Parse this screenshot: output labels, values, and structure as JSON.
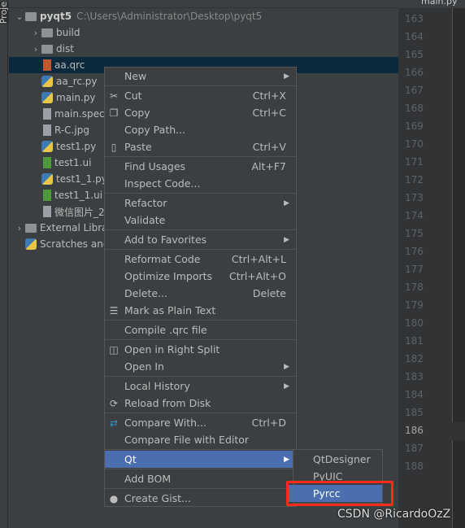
{
  "sidebar_strip": {
    "label": "Proje"
  },
  "editor_tab": {
    "label": "main.py"
  },
  "tree": [
    {
      "label": "pyqt5",
      "path": "C:\\Users\\Administrator\\Desktop\\pyqt5",
      "icon": "folder-icon",
      "level": 0,
      "expanded": true
    },
    {
      "label": "build",
      "icon": "folder-icon",
      "level": 1,
      "collapsed": true
    },
    {
      "label": "dist",
      "icon": "folder-icon",
      "level": 1,
      "collapsed": true
    },
    {
      "label": "aa.qrc",
      "icon": "qrc-file-icon",
      "level": 1,
      "selected": true
    },
    {
      "label": "aa_rc.py",
      "icon": "python-file-icon",
      "level": 1
    },
    {
      "label": "main.py",
      "icon": "python-file-icon",
      "level": 1
    },
    {
      "label": "main.spec",
      "icon": "text-file-icon",
      "level": 1
    },
    {
      "label": "R-C.jpg",
      "icon": "image-file-icon",
      "level": 1
    },
    {
      "label": "test1.py",
      "icon": "python-file-icon",
      "level": 1
    },
    {
      "label": "test1.ui",
      "icon": "qt-ui-file-icon",
      "level": 1
    },
    {
      "label": "test1_1.py",
      "icon": "python-file-icon",
      "level": 1
    },
    {
      "label": "test1_1.ui",
      "icon": "qt-ui-file-icon",
      "level": 1
    },
    {
      "label": "微信图片_2",
      "icon": "image-file-icon",
      "level": 1
    },
    {
      "label": "External Libraries",
      "icon": "library-icon",
      "level": 0,
      "collapsed": true
    },
    {
      "label": "Scratches and Consoles",
      "icon": "scratches-icon",
      "level": 0
    }
  ],
  "line_numbers": [
    "163",
    "164",
    "165",
    "166",
    "167",
    "168",
    "169",
    "170",
    "171",
    "172",
    "173",
    "174",
    "175",
    "176",
    "177",
    "178",
    "179",
    "180",
    "181",
    "182",
    "183",
    "184",
    "185",
    "186",
    "187",
    "188"
  ],
  "current_line": "186",
  "context_menu": [
    {
      "label": "New",
      "submenu": true
    },
    {
      "sep": true
    },
    {
      "label": "Cut",
      "shortcut": "Ctrl+X",
      "icon": "scissors-icon"
    },
    {
      "label": "Copy",
      "shortcut": "Ctrl+C",
      "icon": "copy-icon"
    },
    {
      "label": "Copy Path..."
    },
    {
      "label": "Paste",
      "shortcut": "Ctrl+V",
      "icon": "paste-icon"
    },
    {
      "sep": true
    },
    {
      "label": "Find Usages",
      "shortcut": "Alt+F7"
    },
    {
      "label": "Inspect Code..."
    },
    {
      "sep": true
    },
    {
      "label": "Refactor",
      "submenu": true
    },
    {
      "label": "Validate"
    },
    {
      "sep": true
    },
    {
      "label": "Add to Favorites",
      "submenu": true
    },
    {
      "sep": true
    },
    {
      "label": "Reformat Code",
      "shortcut": "Ctrl+Alt+L"
    },
    {
      "label": "Optimize Imports",
      "shortcut": "Ctrl+Alt+O"
    },
    {
      "label": "Delete...",
      "shortcut": "Delete"
    },
    {
      "label": "Mark as Plain Text",
      "icon": "plain-text-icon"
    },
    {
      "sep": true
    },
    {
      "label": "Compile .qrc file"
    },
    {
      "sep": true
    },
    {
      "label": "Open in Right Split",
      "icon": "split-icon"
    },
    {
      "label": "Open In",
      "submenu": true
    },
    {
      "sep": true
    },
    {
      "label": "Local History",
      "submenu": true
    },
    {
      "label": "Reload from Disk",
      "icon": "reload-icon"
    },
    {
      "sep": true
    },
    {
      "label": "Compare With...",
      "shortcut": "Ctrl+D",
      "icon": "compare-icon"
    },
    {
      "label": "Compare File with Editor"
    },
    {
      "sep": true
    },
    {
      "label": "Qt",
      "submenu": true,
      "highlighted": true
    },
    {
      "sep": true
    },
    {
      "label": "Add BOM"
    },
    {
      "sep": true
    },
    {
      "label": "Create Gist...",
      "icon": "github-icon"
    }
  ],
  "qt_submenu": [
    {
      "label": "QtDesigner"
    },
    {
      "label": "PyUIC"
    },
    {
      "label": "Pyrcc",
      "highlighted": true
    }
  ],
  "watermark": "CSDN @RicardoOzZ",
  "colors": {
    "selection": "#4b6eaf",
    "tree_selection": "#0d293e",
    "annotation_box": "#ff2a1a"
  }
}
